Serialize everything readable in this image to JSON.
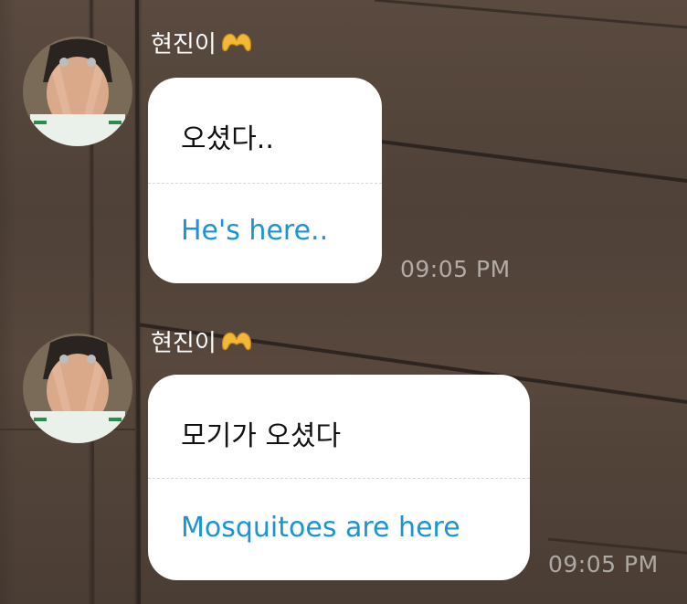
{
  "colors": {
    "wall": "#53443a",
    "bubble": "#ffffff",
    "original_text": "#111111",
    "translation_text": "#1b94d4",
    "timestamp": "rgba(255,255,255,0.55)"
  },
  "messages": [
    {
      "sender_name": "현진이",
      "sender_emoji_icon": "heart-hands-icon",
      "original": "오셨다..",
      "translation": "He's here..",
      "timestamp": "09:05 PM"
    },
    {
      "sender_name": "현진이",
      "sender_emoji_icon": "heart-hands-icon",
      "original": "모기가 오셨다",
      "translation": "Mosquitoes are here",
      "timestamp": "09:05 PM"
    }
  ]
}
